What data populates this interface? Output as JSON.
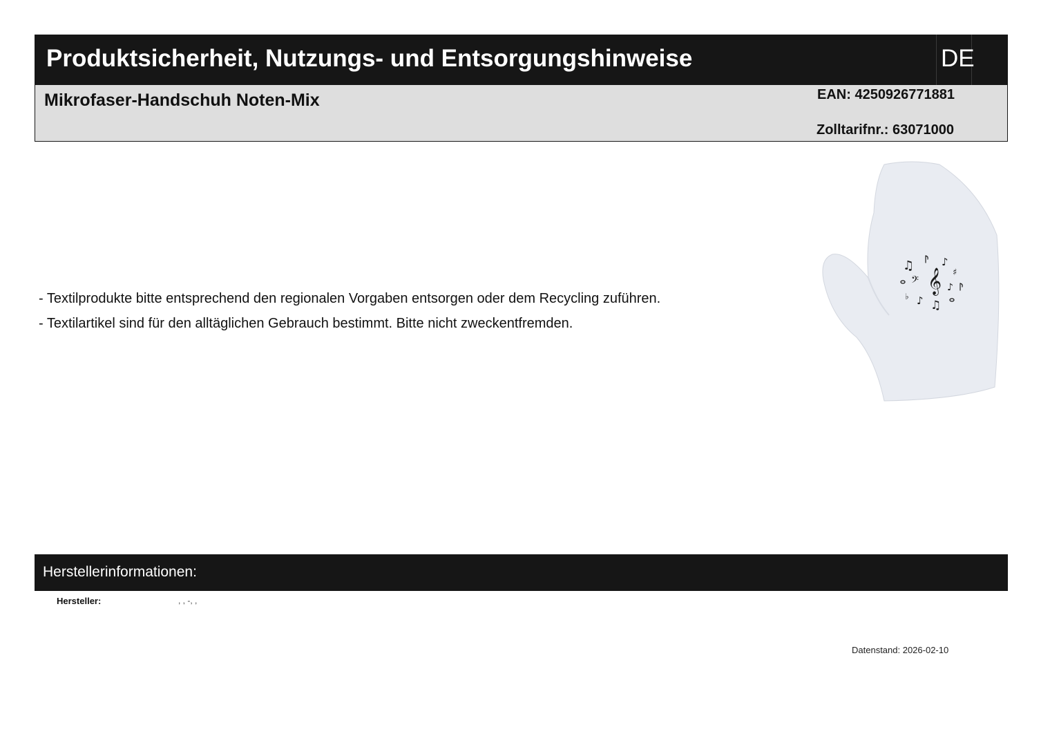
{
  "header": {
    "title": "Produktsicherheit, Nutzungs- und Entsorgungshinweise",
    "language": "DE"
  },
  "product": {
    "name": "Mikrofaser-Handschuh Noten-Mix",
    "ean": "EAN: 4250926771881",
    "customs_tariff": "Zolltarifnr.: 63071000"
  },
  "notes": [
    "- Textilprodukte bitte entsprechend den regionalen Vorgaben entsorgen oder dem Recycling zuführen.",
    "- Textilartikel sind für den alltäglichen Gebrauch bestimmt. Bitte nicht zweckentfremden."
  ],
  "manufacturer": {
    "section_title": "Herstellerinformationen:",
    "label": "Hersteller:",
    "value": ", ,  -, ,"
  },
  "footer": {
    "date": "Datenstand: 2026-02-10"
  },
  "image": {
    "subject": "microfiber-mitten-with-music-notes",
    "colors": {
      "fabric": "#e9ecf2",
      "print": "#1a1a1a"
    }
  }
}
